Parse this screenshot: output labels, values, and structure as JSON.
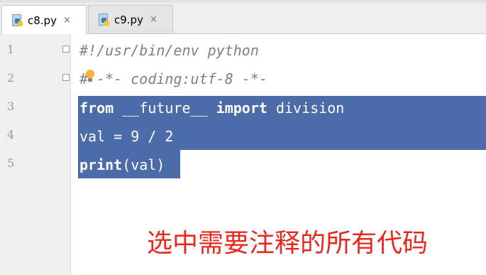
{
  "tabs": [
    {
      "label": "c8.py",
      "close": "×"
    },
    {
      "label": "c9.py",
      "close": "×"
    }
  ],
  "gutter": {
    "line_numbers": [
      "1",
      "2",
      "3",
      "4",
      "5"
    ]
  },
  "code": {
    "line1": "#!/usr/bin/env python",
    "line2": "# -*- coding:utf-8 -*-",
    "line3_kw1": "from",
    "line3_mid": " __future__ ",
    "line3_kw2": "import",
    "line3_rest": " division",
    "line4": "val = 9 / 2",
    "line5_kw": "print",
    "line5_rest": "(val)"
  },
  "overlay_text": "选中需要注释的所有代码",
  "colors": {
    "selection": "#4c6ba9",
    "overlay": "#e8281f",
    "comment": "#808080"
  },
  "icons": [
    "python-file-icon",
    "close-icon",
    "fold-marker-icon",
    "lightbulb-icon"
  ]
}
